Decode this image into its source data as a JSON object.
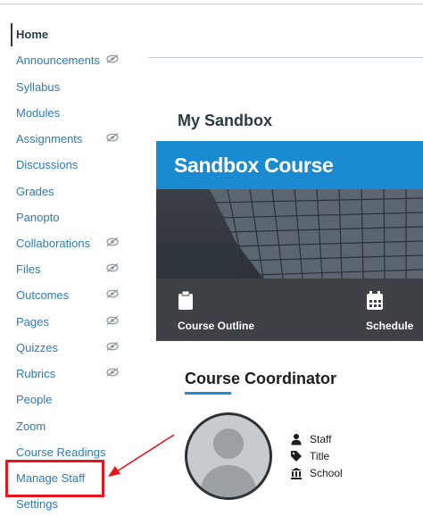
{
  "sidebar": {
    "items": [
      {
        "label": "Home",
        "active": true,
        "hidden_icon": false
      },
      {
        "label": "Announcements",
        "hidden_icon": true
      },
      {
        "label": "Syllabus",
        "hidden_icon": false
      },
      {
        "label": "Modules",
        "hidden_icon": false
      },
      {
        "label": "Assignments",
        "hidden_icon": true
      },
      {
        "label": "Discussions",
        "hidden_icon": false
      },
      {
        "label": "Grades",
        "hidden_icon": false
      },
      {
        "label": "Panopto",
        "hidden_icon": false
      },
      {
        "label": "Collaborations",
        "hidden_icon": true
      },
      {
        "label": "Files",
        "hidden_icon": true
      },
      {
        "label": "Outcomes",
        "hidden_icon": true
      },
      {
        "label": "Pages",
        "hidden_icon": true
      },
      {
        "label": "Quizzes",
        "hidden_icon": true
      },
      {
        "label": "Rubrics",
        "hidden_icon": true
      },
      {
        "label": "People",
        "hidden_icon": false
      },
      {
        "label": "Zoom",
        "hidden_icon": false
      },
      {
        "label": "Course Readings",
        "hidden_icon": false
      },
      {
        "label": "Manage Staff",
        "hidden_icon": false,
        "highlighted": true
      },
      {
        "label": "Settings",
        "hidden_icon": false
      }
    ]
  },
  "main": {
    "page_title": "My Sandbox",
    "banner_title": "Sandbox Course",
    "tiles": [
      {
        "label": "Course Outline",
        "icon": "clipboard-icon"
      },
      {
        "label": "Schedule",
        "icon": "calendar-icon"
      }
    ],
    "coordinator": {
      "heading": "Course Coordinator",
      "fields": [
        {
          "label": "Staff",
          "icon": "person-icon"
        },
        {
          "label": "Title",
          "icon": "tag-icon"
        },
        {
          "label": "School",
          "icon": "institution-icon"
        }
      ]
    }
  },
  "colors": {
    "link": "#2d7cb6",
    "banner": "#1a8bd0",
    "highlight": "#e8141c",
    "text": "#2d3b45"
  }
}
